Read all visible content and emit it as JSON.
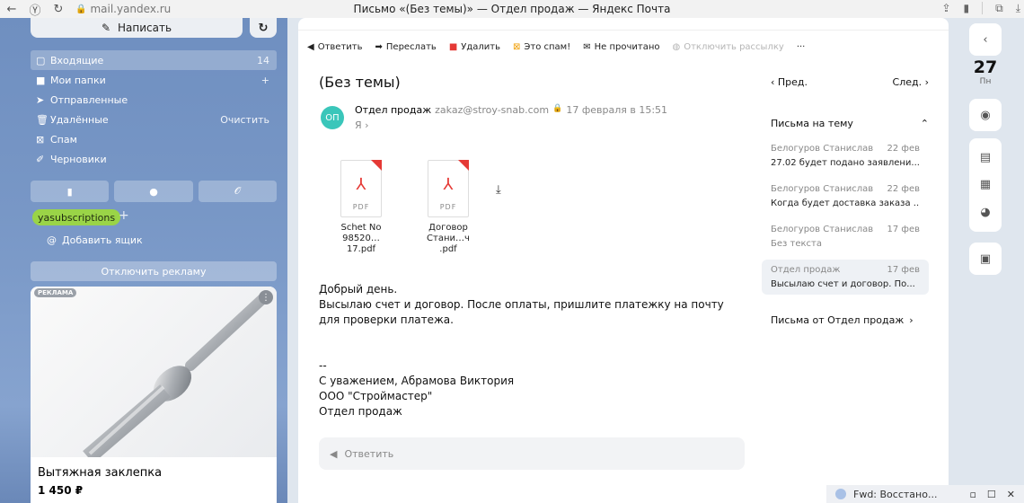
{
  "browser": {
    "url": "mail.yandex.ru",
    "title": "Письмо «(Без темы)» — Отдел продаж — Яндекс Почта"
  },
  "sidebar": {
    "compose": "Написать",
    "folders": [
      {
        "label": "Входящие",
        "count": "14"
      },
      {
        "label": "Мои папки",
        "count": "+"
      },
      {
        "label": "Отправленные",
        "count": ""
      },
      {
        "label": "Удалённые",
        "count": "Очистить"
      },
      {
        "label": "Спам",
        "count": ""
      },
      {
        "label": "Черновики",
        "count": ""
      }
    ],
    "tag": "yasubscriptions",
    "add_box": "Добавить ящик",
    "disable_ads": "Отключить рекламу",
    "ad": {
      "label": "РЕКЛАМА",
      "title": "Вытяжная заклепка",
      "price": "1 450 ₽"
    }
  },
  "toolbar": {
    "reply": "Ответить",
    "forward": "Переслать",
    "delete": "Удалить",
    "spam": "Это спам!",
    "unread": "Не прочитано",
    "unsubscribe": "Отключить рассылку",
    "more": "···"
  },
  "letter": {
    "subject": "(Без темы)",
    "avatar": "ОП",
    "sender_name": "Отдел продаж",
    "sender_email": "zakaz@stroy-snab.com",
    "date": "17 февраля в 15:51",
    "recipient": "Я ›",
    "attachments": [
      {
        "type": "PDF",
        "name_line1": "Schet No",
        "name_line2": "98520…17.pdf"
      },
      {
        "type": "PDF",
        "name_line1": "Договор",
        "name_line2": "Стани…ч .pdf"
      }
    ],
    "body": [
      "Добрый день.",
      "Высылаю счет и договор. После оплаты, пришлите платежку на почту для проверки платежа.",
      "",
      "",
      "--",
      "С уважением, Абрамова Виктория",
      "ООО \"Строймастер\"",
      "Отдел продаж"
    ],
    "reply_placeholder": "Ответить"
  },
  "thread": {
    "prev": "‹  Пред.",
    "next": "След.  ›",
    "header": "Письма на тему",
    "items": [
      {
        "from": "Белогуров Станислав",
        "date": "22 фев",
        "text": "27.02 будет подано заявлени..."
      },
      {
        "from": "Белогуров Станислав",
        "date": "22 фев",
        "text": "Когда будет доставка заказа ..."
      },
      {
        "from": "Белогуров Станислав",
        "date": "17 фев",
        "text": "Без текста"
      },
      {
        "from": "Отдел продаж",
        "date": "17 фев",
        "text": "Высылаю счет и договор. По..."
      }
    ],
    "from_link": "Письма от Отдел продаж"
  },
  "rail": {
    "day": "27",
    "weekday": "Пн"
  },
  "notification": {
    "text": "Fwd: Восстано..."
  },
  "colors": {
    "accent_green": "#9ad447",
    "avatar": "#3ac6ba",
    "pdf_red": "#e53935"
  }
}
